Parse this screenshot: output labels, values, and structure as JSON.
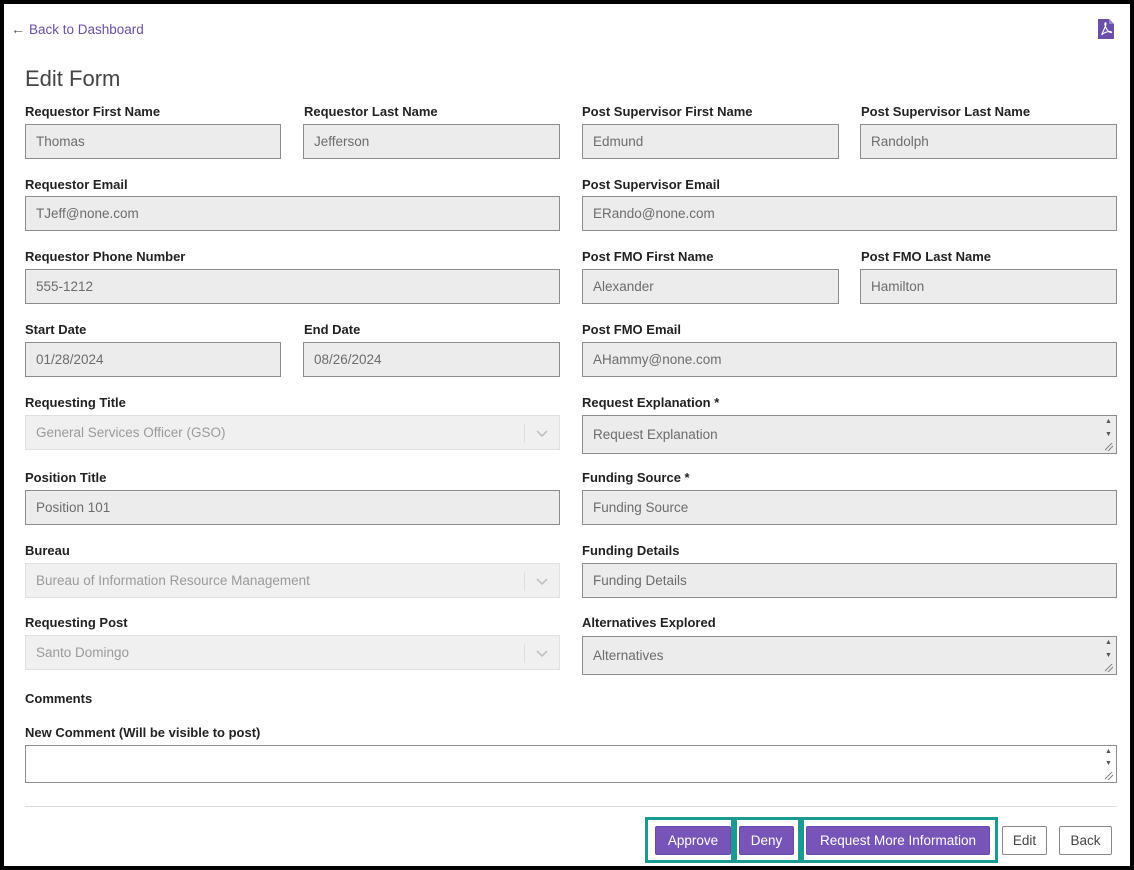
{
  "nav": {
    "back_label": "Back to Dashboard",
    "pdf_icon": "pdf-icon"
  },
  "page": {
    "title": "Edit Form"
  },
  "fields": {
    "requestor_first_name": {
      "label": "Requestor First Name",
      "value": "Thomas"
    },
    "requestor_last_name": {
      "label": "Requestor Last Name",
      "value": "Jefferson"
    },
    "post_supervisor_first_name": {
      "label": "Post Supervisor First Name",
      "value": "Edmund"
    },
    "post_supervisor_last_name": {
      "label": "Post Supervisor Last Name",
      "value": "Randolph"
    },
    "requestor_email": {
      "label": "Requestor Email",
      "value": "TJeff@none.com"
    },
    "post_supervisor_email": {
      "label": "Post Supervisor Email",
      "value": "ERando@none.com"
    },
    "requestor_phone": {
      "label": "Requestor Phone Number",
      "value": "555-1212"
    },
    "post_fmo_first_name": {
      "label": "Post FMO First Name",
      "value": "Alexander"
    },
    "post_fmo_last_name": {
      "label": "Post FMO Last Name",
      "value": "Hamilton"
    },
    "start_date": {
      "label": "Start Date",
      "value": "01/28/2024"
    },
    "end_date": {
      "label": "End Date",
      "value": "08/26/2024"
    },
    "post_fmo_email": {
      "label": "Post FMO Email",
      "value": "AHammy@none.com"
    },
    "requesting_title": {
      "label": "Requesting Title",
      "value": "General Services Officer (GSO)"
    },
    "request_explanation": {
      "label": "Request Explanation *",
      "placeholder": "Request Explanation"
    },
    "position_title": {
      "label": "Position Title",
      "value": "Position 101"
    },
    "funding_source": {
      "label": "Funding Source *",
      "placeholder": "Funding Source"
    },
    "bureau": {
      "label": "Bureau",
      "value": "Bureau of Information Resource Management"
    },
    "funding_details": {
      "label": "Funding Details",
      "placeholder": "Funding Details"
    },
    "requesting_post": {
      "label": "Requesting Post",
      "value": "Santo Domingo"
    },
    "alternatives_explored": {
      "label": "Alternatives Explored",
      "placeholder": "Alternatives"
    }
  },
  "comments": {
    "heading": "Comments",
    "new_label": "New Comment (Will be visible to post)",
    "value": ""
  },
  "actions": {
    "approve": "Approve",
    "deny": "Deny",
    "request_more": "Request More Information",
    "edit": "Edit",
    "back": "Back"
  },
  "colors": {
    "accent": "#7654b8",
    "highlight": "#1a9a92"
  }
}
